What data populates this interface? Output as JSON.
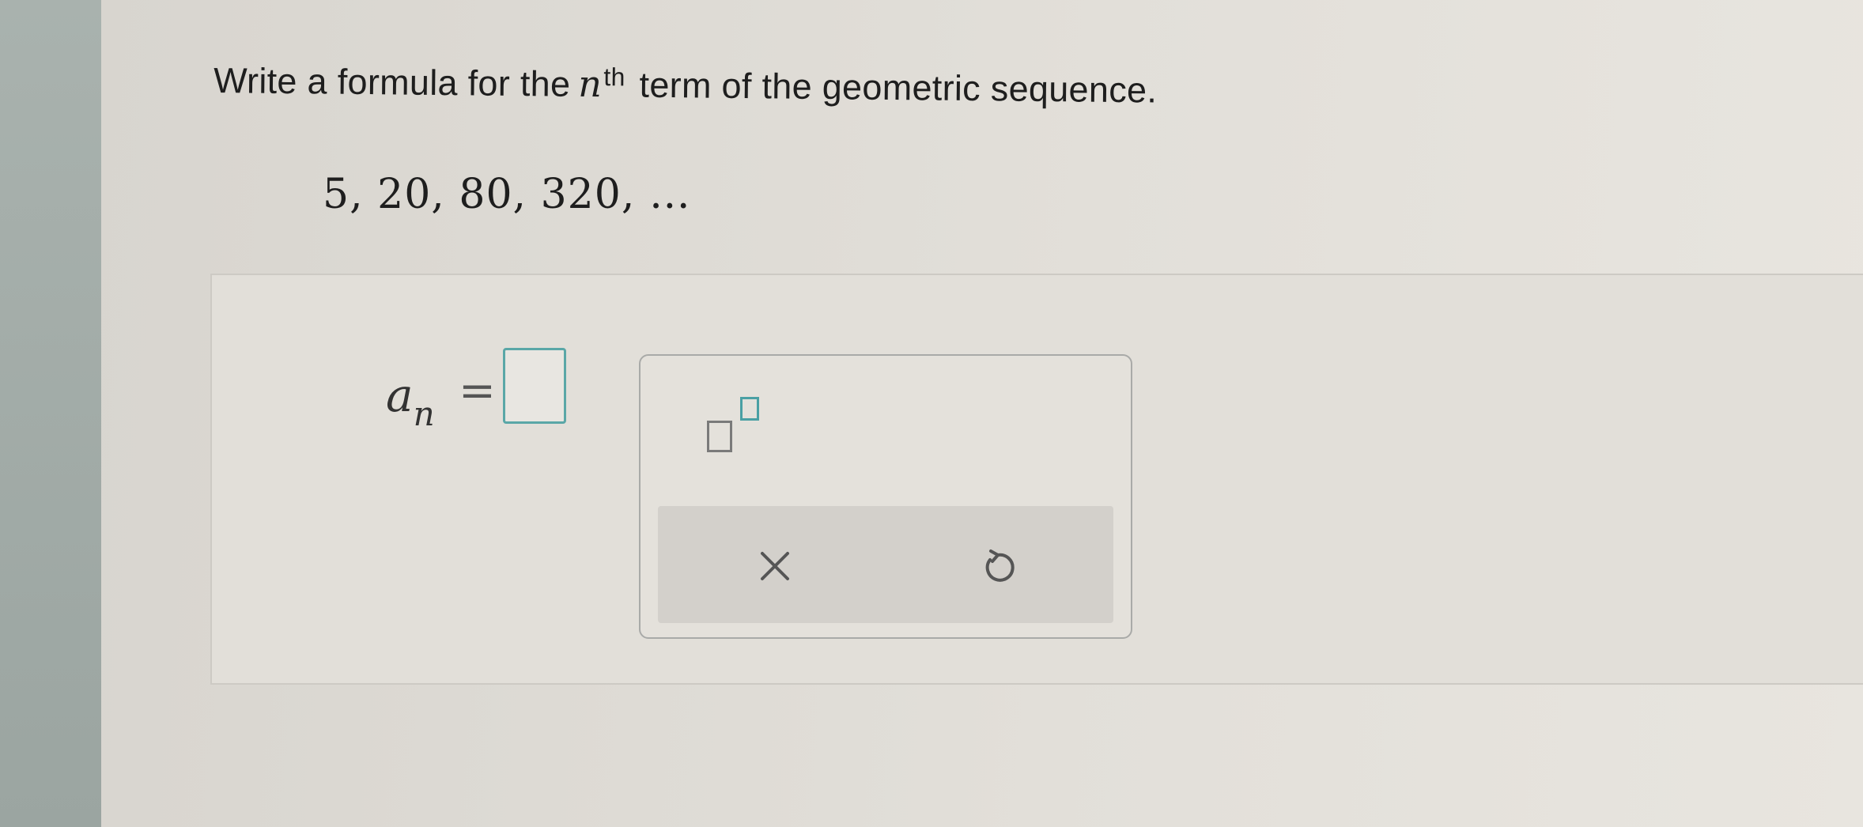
{
  "question": {
    "prefix": "Write a formula for the",
    "variable": "n",
    "superscript": "th",
    "suffix": "term of the geometric sequence."
  },
  "sequence": {
    "text": "5,  20,  80,  320,  …"
  },
  "answer": {
    "lhs_base": "a",
    "lhs_subscript": "n",
    "equals": "=",
    "value": ""
  },
  "palette": {
    "buttons": [
      {
        "name": "exponent-template",
        "icon": "superscript-template-icon"
      },
      {
        "name": "clear",
        "icon": "close-icon"
      },
      {
        "name": "undo",
        "icon": "undo-icon"
      }
    ],
    "colors": {
      "accent_teal": "#4aa0a4",
      "icon_gray": "#555555"
    }
  }
}
